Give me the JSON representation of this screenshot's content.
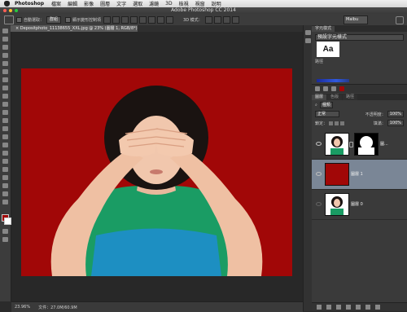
{
  "menubar": {
    "app": "Photoshop",
    "items": [
      "檔案",
      "編輯",
      "影像",
      "圖層",
      "文字",
      "選取",
      "濾鏡",
      "3D",
      "檢視",
      "視窗",
      "說明"
    ]
  },
  "titlebar": {
    "title": "Adobe Photoshop CC 2014"
  },
  "options": {
    "auto_select_label": "自動選取：",
    "auto_select_value": "群組",
    "transform_label": "顯示變形控制項",
    "mode_3d_label": "3D 模式：",
    "workspace": "Maibu"
  },
  "document": {
    "tab_title": "Depositphoto_11138655_XXL.jpg @ 23% (圖層 1, RGB/8*)",
    "close": "×"
  },
  "status": {
    "zoom": "23.96%",
    "doc_info": "文件：27.0M/60.9M"
  },
  "panels": {
    "top_tab": "字元樣式",
    "top_dropdown": "預設字元樣式",
    "char_preview": "Aa",
    "paths_label": "路徑",
    "colors": {
      "canvas_red": "#a10707",
      "layer_highlight": "#7a8696",
      "spectrum_blue": "#305adf"
    }
  },
  "layers": {
    "tabs": [
      "圖層",
      "色版",
      "路徑"
    ],
    "kind_filter": "種類",
    "blend_mode": "正常",
    "opacity_label": "不透明度：",
    "opacity_value": "100%",
    "lock_label": "鎖定：",
    "fill_label": "填滿：",
    "fill_value": "100%",
    "items": [
      {
        "name": "圖..."
      },
      {
        "name": "圖層 1"
      },
      {
        "name": "圖層 0"
      }
    ]
  }
}
